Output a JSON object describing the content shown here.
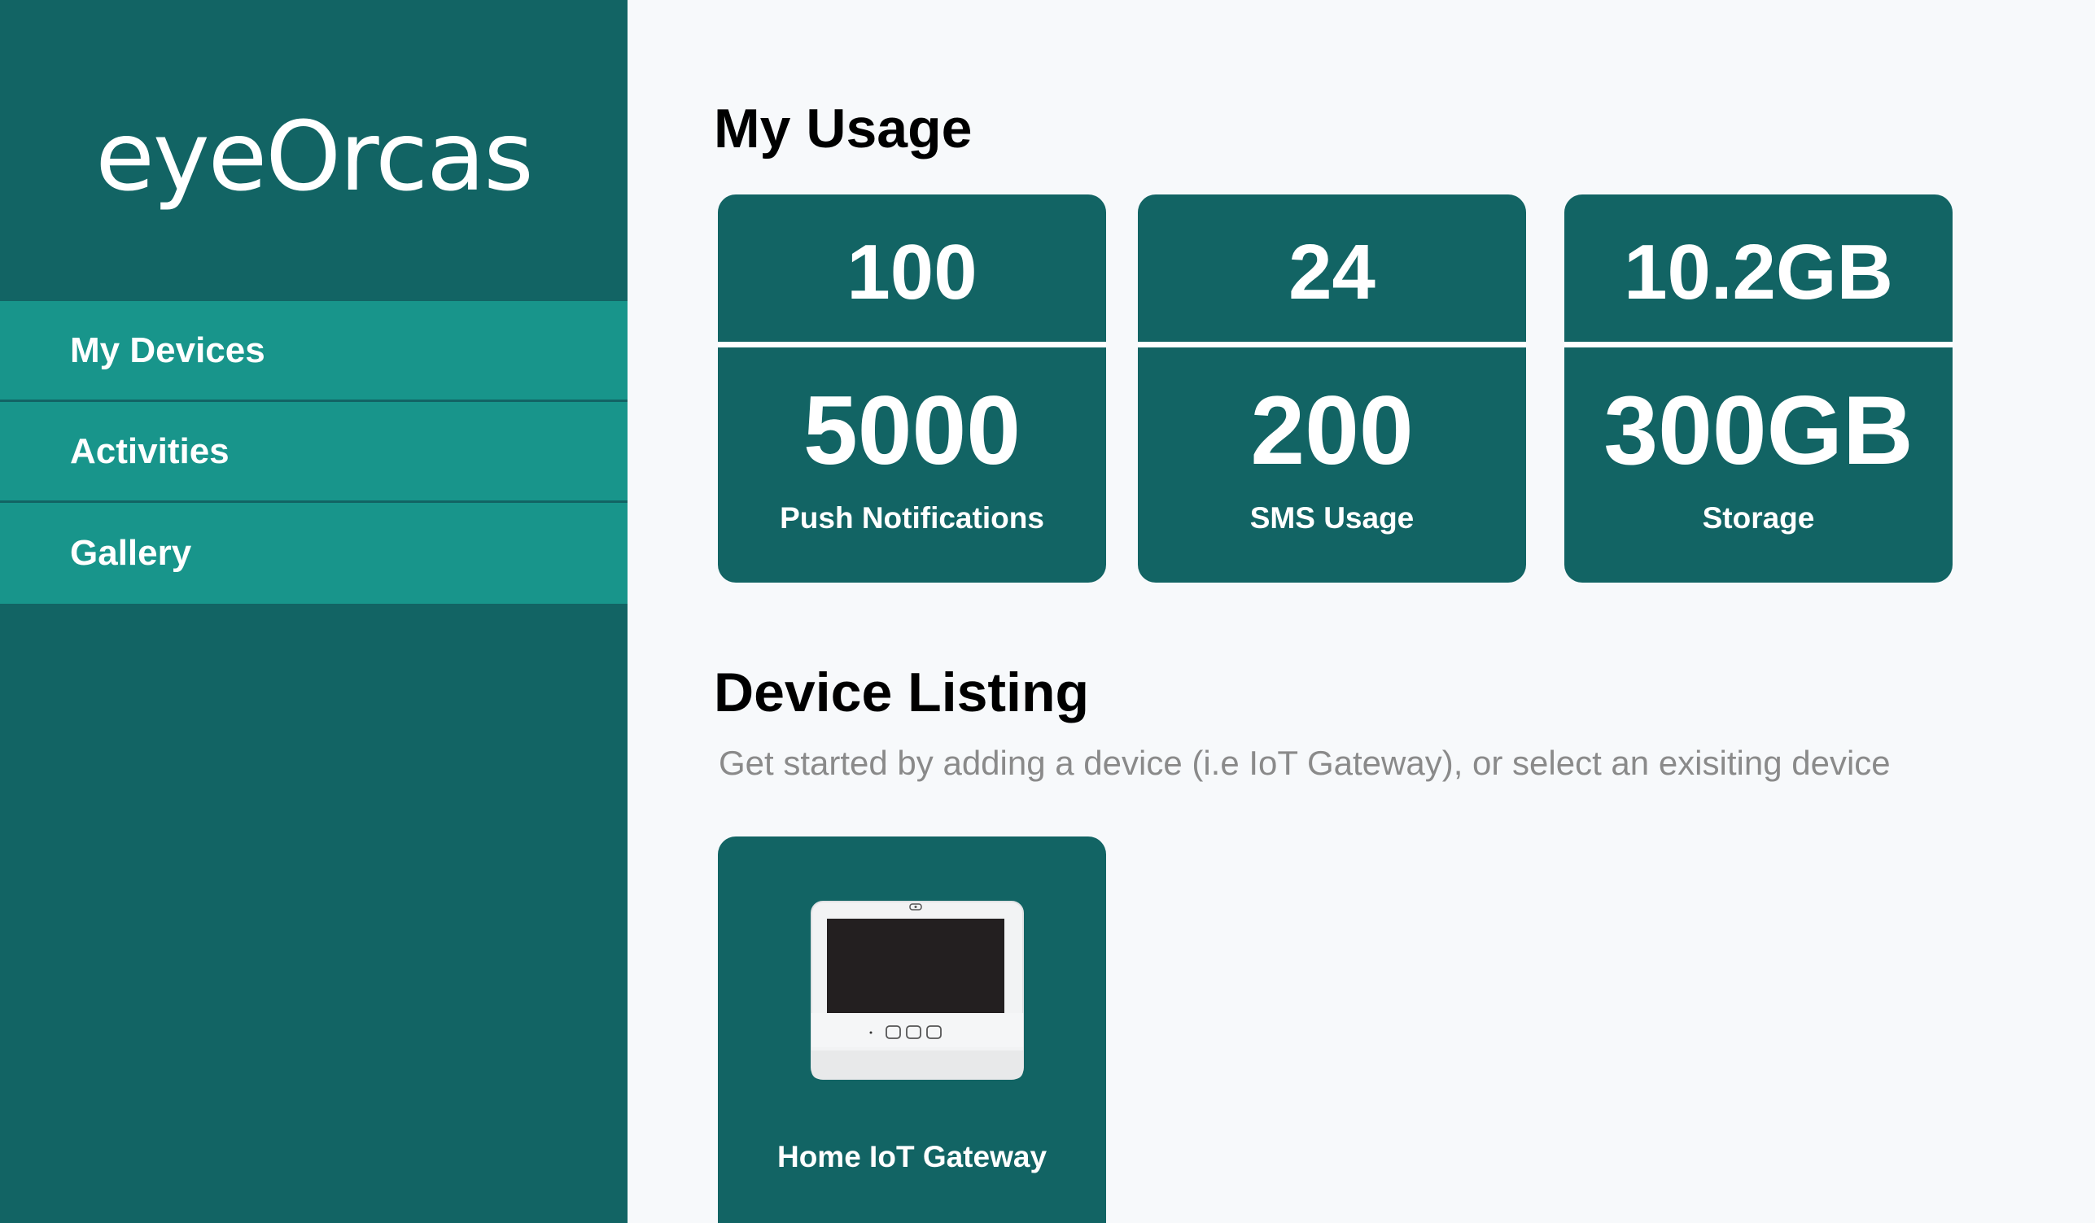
{
  "app": {
    "logo_text": "eyeOrcas"
  },
  "sidebar": {
    "items": [
      {
        "label": "My Devices"
      },
      {
        "label": "Activities"
      },
      {
        "label": "Gallery"
      }
    ]
  },
  "usage": {
    "title": "My Usage",
    "cards": [
      {
        "current": "100",
        "limit": "5000",
        "label": "Push Notifications"
      },
      {
        "current": "24",
        "limit": "200",
        "label": "SMS Usage"
      },
      {
        "current": "10.2GB",
        "limit": "300GB",
        "label": "Storage"
      }
    ]
  },
  "listing": {
    "title": "Device Listing",
    "subtitle": "Get started by adding a device (i.e IoT Gateway), or select an exisiting device",
    "devices": [
      {
        "name": "Home IoT Gateway",
        "icon": "iot-gateway-device-image"
      }
    ]
  },
  "colors": {
    "sidebar_bg": "#126464",
    "nav_item_bg": "#18958b",
    "card_bg": "#126464",
    "page_bg": "#f7f9fb",
    "subtitle_text": "#8a8a8a"
  }
}
